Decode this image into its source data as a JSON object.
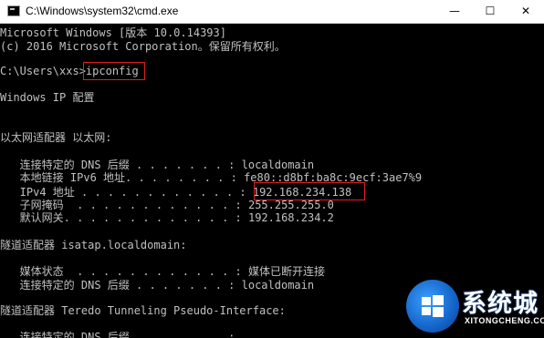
{
  "window": {
    "title": "C:\\Windows\\system32\\cmd.exe",
    "minimize_glyph": "—",
    "maximize_glyph": "☐",
    "close_glyph": "✕"
  },
  "console": {
    "lines": [
      "Microsoft Windows [版本 10.0.14393]",
      "(c) 2016 Microsoft Corporation。保留所有权利。",
      "",
      "C:\\Users\\xxs>ipconfig",
      "",
      "Windows IP 配置",
      "",
      "",
      "以太网适配器 以太网:",
      "",
      "   连接特定的 DNS 后缀 . . . . . . . : localdomain",
      "   本地链接 IPv6 地址. . . . . . . . : fe80::d8bf:ba8c:9ecf:3ae7%9",
      "   IPv4 地址 . . . . . . . . . . . . : 192.168.234.138",
      "   子网掩码  . . . . . . . . . . . . : 255.255.255.0",
      "   默认网关. . . . . . . . . . . . . : 192.168.234.2",
      "",
      "隧道适配器 isatap.localdomain:",
      "",
      "   媒体状态  . . . . . . . . . . . . : 媒体已断开连接",
      "   连接特定的 DNS 后缀 . . . . . . . : localdomain",
      "",
      "隧道适配器 Teredo Tunneling Pseudo-Interface:",
      "",
      "   连接特定的 DNS 后缀 . . . . . . . :"
    ]
  },
  "watermark": {
    "brand": "系统城",
    "url": "XITONGCHENG.COM"
  },
  "colors": {
    "console_background": "#000000",
    "console_text": "#c0c0c0",
    "highlight_border": "#e02020",
    "title_bar": "#ffffff"
  }
}
